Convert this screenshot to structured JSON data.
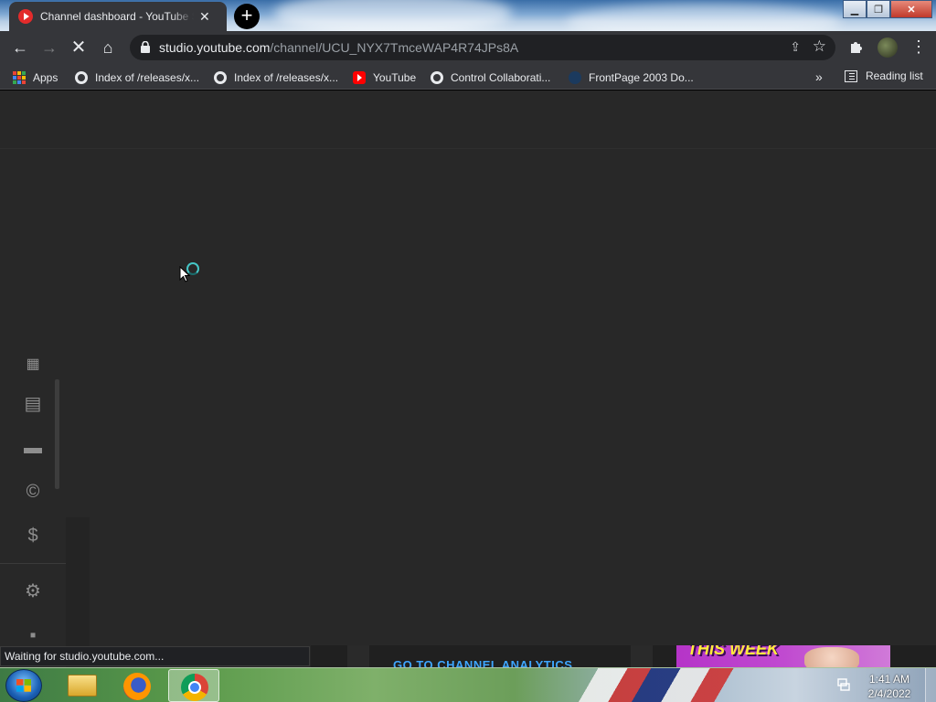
{
  "browser": {
    "tab": {
      "title": "Channel dashboard - YouTube Studio",
      "close": "✕"
    },
    "new_tab": "+",
    "window_controls": {
      "minimize": "▁",
      "maximize": "❐",
      "close": "✕"
    },
    "nav": {
      "back": "←",
      "forward": "→",
      "reload": "✕",
      "home": "⌂"
    },
    "address": {
      "host": "studio.youtube.com",
      "path": "/channel/UCU_NYX7TmceWAP4R74JPs8A"
    },
    "omnibox_icons": {
      "share": "⇪",
      "star": "☆"
    },
    "menu": "⋮",
    "bookmarks": [
      {
        "label": "Apps",
        "icon": "apps-icon"
      },
      {
        "label": "Index of /releases/x...",
        "icon": "globe-icon"
      },
      {
        "label": "Index of /releases/x...",
        "icon": "globe-icon"
      },
      {
        "label": "YouTube",
        "icon": "youtube-icon"
      },
      {
        "label": "Control Collaborati...",
        "icon": "globe-icon"
      },
      {
        "label": "FrontPage 2003 Do...",
        "icon": "frontpage-icon"
      }
    ],
    "bookmarks_more": "»",
    "reading_list": "Reading list",
    "status": "Waiting for studio.youtube.com..."
  },
  "page": {
    "sidebar_icons": [
      "subtitles-icon",
      "comments-icon",
      "subtitles-icon",
      "copyright-icon",
      "monetization-icon",
      "settings-icon",
      "feedback-icon"
    ],
    "sidebar_glyphs": {
      "top": "▦",
      "comments": "▤",
      "subtitles": "▬",
      "copyright": "©",
      "monetization": "$",
      "settings": "⚙",
      "feedback": "▪"
    },
    "analytics_link": "GO TO CHANNEL ANALYTICS",
    "thumbnail_text": "THIS WEEK"
  },
  "taskbar": {
    "time": "1:41 AM",
    "date": "2/4/2022",
    "apps": [
      "windows-explorer",
      "firefox",
      "chrome"
    ]
  },
  "colors": {
    "page_bg": "#282828",
    "toolbar_bg": "#35363a",
    "omnibox_bg": "#202124",
    "link_blue": "#3ea6ff",
    "spinner": "#45c6c6"
  }
}
